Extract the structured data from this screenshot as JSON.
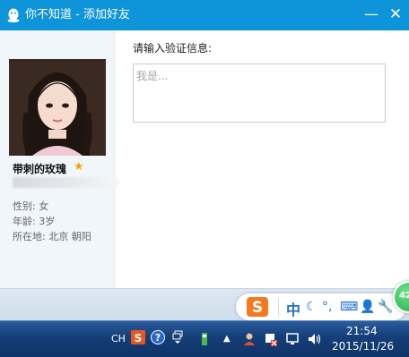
{
  "window": {
    "title": "你不知道 - 添加好友",
    "minimize_glyph": "—",
    "close_glyph": "✕"
  },
  "profile": {
    "nickname": "带刺的玫瑰",
    "gender": "性别: 女",
    "age": "年龄: 3岁",
    "location": "所在地: 北京  朝阳"
  },
  "verify": {
    "label": "请输入验证信息:",
    "placeholder": "我是..."
  },
  "ime": {
    "mode": "中",
    "punct": "°,"
  },
  "floating_ball": {
    "value": "42"
  },
  "taskbar": {
    "lang": "CH",
    "time": "21:54",
    "date": "2015/11/26"
  },
  "colors": {
    "titlebar": "#0e94d8",
    "accent": "#1f6fcc",
    "star": "#f0a800"
  }
}
